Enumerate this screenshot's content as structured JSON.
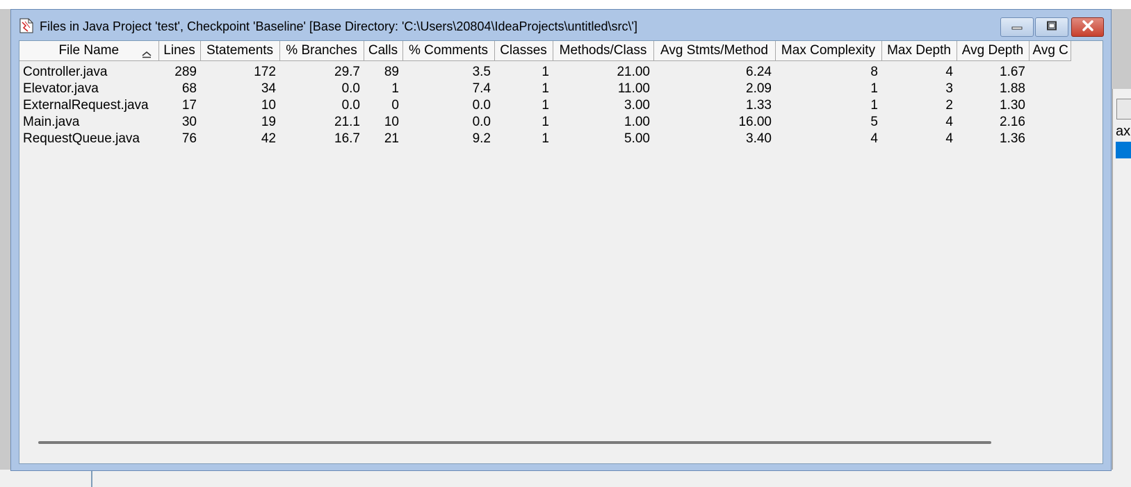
{
  "window": {
    "title": "Files in Java Project 'test', Checkpoint 'Baseline'  [Base Directory: 'C:\\Users\\20804\\IdeaProjects\\untitled\\src\\']"
  },
  "table": {
    "columns": [
      "File Name",
      "Lines",
      "Statements",
      "% Branches",
      "Calls",
      "% Comments",
      "Classes",
      "Methods/Class",
      "Avg Stmts/Method",
      "Max Complexity",
      "Max Depth",
      "Avg Depth",
      "Avg C"
    ],
    "rows": [
      [
        "Controller.java",
        "289",
        "172",
        "29.7",
        "89",
        "3.5",
        "1",
        "21.00",
        "6.24",
        "8",
        "4",
        "1.67",
        ""
      ],
      [
        "Elevator.java",
        "68",
        "34",
        "0.0",
        "1",
        "7.4",
        "1",
        "11.00",
        "2.09",
        "1",
        "3",
        "1.88",
        ""
      ],
      [
        "ExternalRequest.java",
        "17",
        "10",
        "0.0",
        "0",
        "0.0",
        "1",
        "3.00",
        "1.33",
        "1",
        "2",
        "1.30",
        ""
      ],
      [
        "Main.java",
        "30",
        "19",
        "21.1",
        "10",
        "0.0",
        "1",
        "1.00",
        "16.00",
        "5",
        "4",
        "2.16",
        ""
      ],
      [
        "RequestQueue.java",
        "76",
        "42",
        "16.7",
        "21",
        "9.2",
        "1",
        "5.00",
        "3.40",
        "4",
        "4",
        "1.36",
        ""
      ]
    ]
  },
  "background": {
    "partial_text": "ax"
  },
  "icons": {
    "app": "spreadsheet-doc-icon",
    "sort": "sort-ascending-icon",
    "minimize": "minimize-icon",
    "maximize": "maximize-icon",
    "close": "close-icon"
  },
  "colors": {
    "title_bar": "#aec6e6",
    "close_button": "#c8402e",
    "selection": "#0078d7"
  }
}
